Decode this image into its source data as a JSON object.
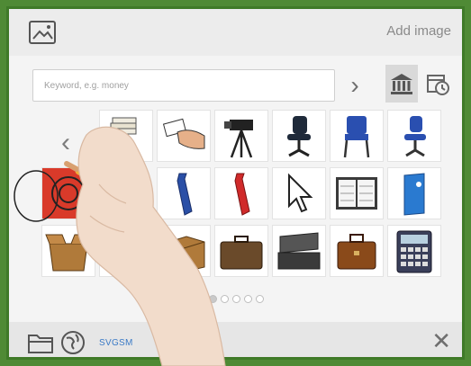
{
  "header": {
    "add_image_label": "Add image",
    "image_icon": "image-icon"
  },
  "search": {
    "placeholder": "Keyword, e.g. money",
    "value": ""
  },
  "toolbar": {
    "next_arrow": "›",
    "prev_arrow": "‹",
    "tabs": [
      {
        "icon": "bank-icon",
        "selected": true
      },
      {
        "icon": "history-icon",
        "selected": false
      }
    ]
  },
  "grid": {
    "items": [
      {
        "icon": "stack-of-papers-icon"
      },
      {
        "icon": "hand-giving-card-icon"
      },
      {
        "icon": "video-camera-icon"
      },
      {
        "icon": "office-chair-icon"
      },
      {
        "icon": "blue-chair-icon"
      },
      {
        "icon": "blue-office-chair-icon"
      },
      {
        "icon": "red-target-icon"
      },
      {
        "icon": "blue-tie-icon"
      },
      {
        "icon": "red-tie-icon"
      },
      {
        "icon": "cursor-arrow-icon"
      },
      {
        "icon": "planner-book-icon"
      },
      {
        "icon": "blue-binder-icon"
      },
      {
        "icon": "open-box-icon"
      },
      {
        "icon": "cardboard-box-icon"
      },
      {
        "icon": "closed-box-icon"
      },
      {
        "icon": "briefcase-icon"
      },
      {
        "icon": "open-briefcase-icon"
      },
      {
        "icon": "brown-bag-icon"
      },
      {
        "icon": "calculator-icon"
      }
    ]
  },
  "pagination": {
    "pages": 5,
    "current": 1
  },
  "footer": {
    "source_label": "SVGSM",
    "close_label": "✕"
  },
  "colors": {
    "frame_green": "#4f8a35",
    "accent_blue": "#3a7ac6"
  }
}
